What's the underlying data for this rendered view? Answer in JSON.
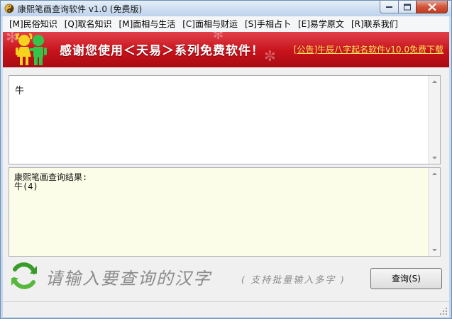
{
  "window": {
    "title": "康熙笔画查询软件 v1.0 (免费版)"
  },
  "menu": [
    "[M]民俗知识",
    "[Q]取名知识",
    "[M]面相与生活",
    "[C]面相与财运",
    "[S]手相占卜",
    "[E]易学原文",
    "[R]联系我们"
  ],
  "banner": {
    "slogan": "感谢您使用＜天易＞系列免费软件！",
    "notice": "[公告]牛辰八字起名软件v10.0免费下载"
  },
  "input": {
    "value": "牛"
  },
  "result": {
    "heading": "康熙笔画查询结果:",
    "lines": [
      "牛(4)"
    ]
  },
  "hint": {
    "main": "请输入要查询的汉字",
    "sub": "( 支持批量输入多字 )"
  },
  "buttons": {
    "query": "查询(S)"
  },
  "icons": {
    "app": "app-icon",
    "refresh": "refresh-icon",
    "kids": "kids-icon"
  },
  "colors": {
    "banner_red": "#c7121b",
    "notice_yellow": "#ffe259",
    "result_bg": "#fcfde8",
    "refresh_green": "#3a9b2a"
  }
}
